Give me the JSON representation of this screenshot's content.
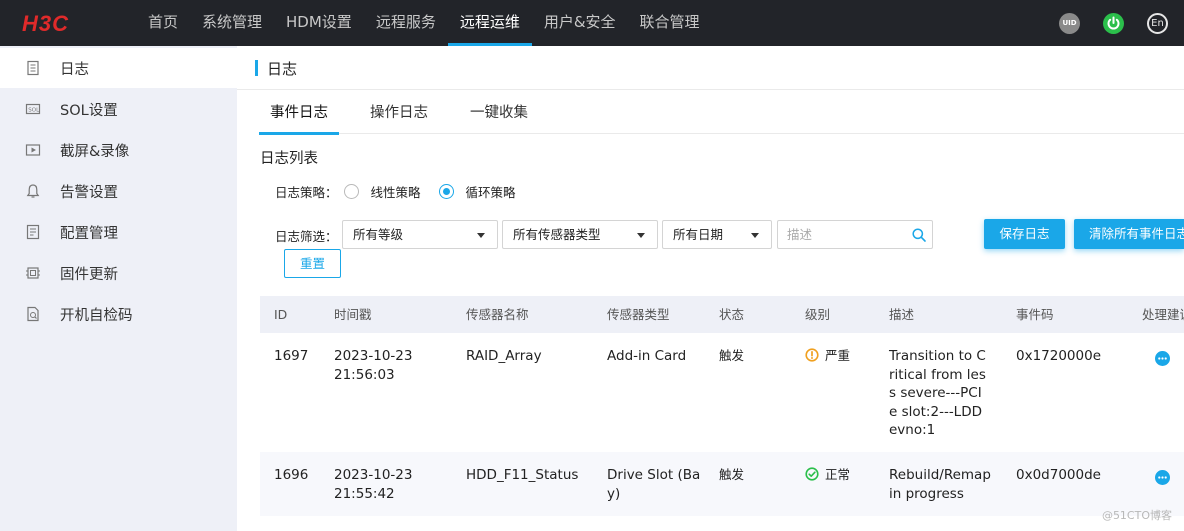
{
  "brand": {
    "logo_text": "H3C",
    "logo_color": "#e02a2a"
  },
  "nav": {
    "items": [
      {
        "label": "首页"
      },
      {
        "label": "系统管理"
      },
      {
        "label": "HDM设置"
      },
      {
        "label": "远程服务"
      },
      {
        "label": "远程运维"
      },
      {
        "label": "用户&安全"
      },
      {
        "label": "联合管理"
      }
    ],
    "active_index": 4,
    "right": {
      "uid_label": "UID",
      "power_icon": "power-icon",
      "lang_label": "En"
    }
  },
  "sidebar": {
    "items": [
      {
        "label": "日志",
        "icon": "log-icon"
      },
      {
        "label": "SOL设置",
        "icon": "sol-icon"
      },
      {
        "label": "截屏&录像",
        "icon": "video-icon"
      },
      {
        "label": "告警设置",
        "icon": "bell-icon"
      },
      {
        "label": "配置管理",
        "icon": "config-icon"
      },
      {
        "label": "固件更新",
        "icon": "firmware-icon"
      },
      {
        "label": "开机自检码",
        "icon": "post-code-icon"
      }
    ],
    "active_index": 0
  },
  "page": {
    "title": "日志",
    "tabs": [
      {
        "label": "事件日志"
      },
      {
        "label": "操作日志"
      },
      {
        "label": "一键收集"
      }
    ],
    "active_tab": 0,
    "section_title": "日志列表",
    "policy": {
      "label": "日志策略：",
      "options": [
        "线性策略",
        "循环策略"
      ],
      "selected": "循环策略"
    },
    "filter": {
      "label": "日志筛选：",
      "level": "所有等级",
      "sensor_type": "所有传感器类型",
      "date": "所有日期",
      "search_placeholder": "描述",
      "reset_label": "重置"
    },
    "buttons": {
      "save_label": "保存日志",
      "clear_label": "清除所有事件日志"
    }
  },
  "table": {
    "columns": [
      "ID",
      "时间戳",
      "传感器名称",
      "传感器类型",
      "状态",
      "级别",
      "描述",
      "事件码",
      "处理建议"
    ],
    "rows": [
      {
        "id": "1697",
        "timestamp_date": "2023-10-23",
        "timestamp_time": "21:56:03",
        "sensor_name": "RAID_Array",
        "sensor_type": "Add-in Card",
        "state": "触发",
        "level": "严重",
        "level_icon": "warning-circle-icon",
        "level_color": "#f0a020",
        "description": "Transition to Critical from less severe---PCIe slot:2---LDDevno:1",
        "event_code": "0x1720000e"
      },
      {
        "id": "1696",
        "timestamp_date": "2023-10-23",
        "timestamp_time": "21:55:42",
        "sensor_name": "HDD_F11_Status",
        "sensor_type": "Drive Slot (Bay)",
        "state": "触发",
        "level": "正常",
        "level_icon": "check-circle-icon",
        "level_color": "#2bbf4b",
        "description": "Rebuild/Remap in progress",
        "event_code": "0x0d7000de"
      }
    ]
  },
  "colors": {
    "accent": "#1aa7e8",
    "topbar": "#222429",
    "sidebar_bg": "#eef0f7"
  },
  "watermark": "@51CTO博客"
}
